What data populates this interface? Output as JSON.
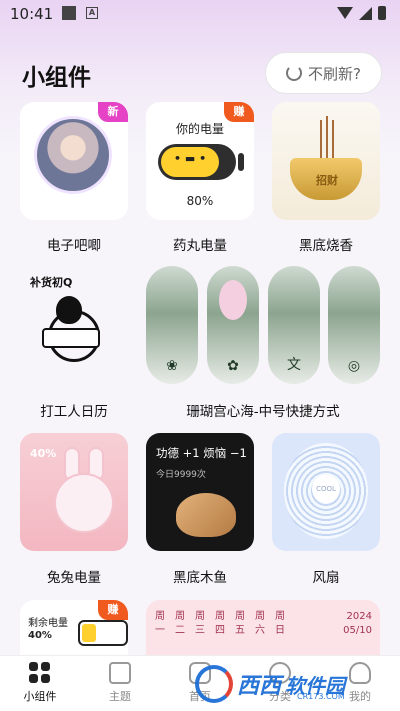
{
  "status_bar": {
    "time": "10:41",
    "sim_indicator": "A"
  },
  "header": {
    "title": "小组件",
    "refresh_label": "不刷新?"
  },
  "widgets": [
    {
      "name": "电子吧唧",
      "badge": "新",
      "badge_color": "#e542c5"
    },
    {
      "name": "药丸电量",
      "badge": "赚",
      "badge_color": "#f05a1e",
      "battery_title": "你的电量",
      "battery_face": "•  ▬  •",
      "battery_percent_text": "80%",
      "battery_level": 0.8
    },
    {
      "name": "黑底烧香",
      "incense_char": "招财"
    },
    {
      "name": "打工人日历",
      "header_text": "补货初Q"
    },
    {
      "name": "珊瑚宫心海-中号快捷方式",
      "shortcut_icons": [
        "❀",
        "✿",
        "文",
        "◎"
      ]
    },
    {
      "name": "兔兔电量",
      "percent": "40%",
      "battery_level": 0.4
    },
    {
      "name": "黑底木鱼",
      "merit_text": "功德 +1   烦恼 −1",
      "today_text": "今日9999次"
    },
    {
      "name": "风扇",
      "fan_text": "COOL"
    },
    {
      "name": "",
      "badge": "赚",
      "badge_color": "#f05a1e",
      "label": "剩余电量",
      "percent": "40%",
      "battery_level": 0.4
    },
    {
      "name": "",
      "weekdays_top": [
        "周",
        "周",
        "周",
        "周",
        "周",
        "周",
        "周"
      ],
      "weekdays_bottom": [
        "一",
        "二",
        "三",
        "四",
        "五",
        "六",
        "日"
      ],
      "year": "2024",
      "date": "05/10"
    }
  ],
  "tabs": [
    {
      "label": "小组件",
      "active": true
    },
    {
      "label": "主题",
      "active": false
    },
    {
      "label": "首页",
      "active": false
    },
    {
      "label": "分类",
      "active": false
    },
    {
      "label": "我的",
      "active": false
    }
  ],
  "watermark": {
    "brand": "西西",
    "brand_sub": "软件园",
    "url": "CR173.COM"
  }
}
